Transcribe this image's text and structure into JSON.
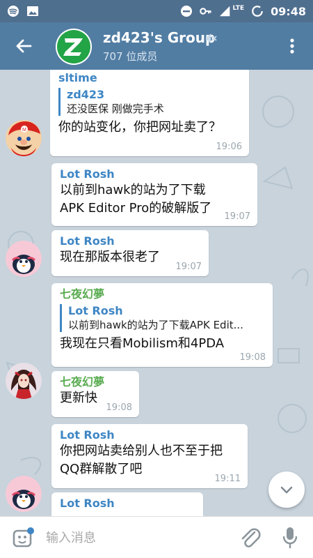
{
  "status_bar": {
    "time": "09:48",
    "network": "LTE",
    "icons": [
      "spotify-icon",
      "image-icon",
      "do-not-disturb-icon",
      "key-icon",
      "signal-icon",
      "battery-icon"
    ]
  },
  "header": {
    "title": "zd423's Group",
    "members": "707 位成员",
    "avatar_letter": "Z",
    "muted": true
  },
  "messages": [
    {
      "sender": "sltime",
      "sender_color": "#3e86c4",
      "reply_name": "zd423",
      "reply_text": "还没医保 刚做完手术",
      "text": "你的站变化，你把网址卖了？",
      "time": "19:06",
      "avatar": "mario-avatar"
    },
    {
      "sender": "Lot Rosh",
      "sender_color": "#3e86c4",
      "text_lines": [
        "以前到hawk的站为了下载",
        "APK Editor Pro的破解版了"
      ],
      "time": "19:07"
    },
    {
      "sender": "Lot Rosh",
      "sender_color": "#3e86c4",
      "text": "现在那版本很老了",
      "time": "19:07",
      "avatar": "penguin-avatar"
    },
    {
      "sender": "七夜幻夢",
      "sender_color": "#5aac52",
      "reply_name": "Lot Rosh",
      "reply_text": "以前到hawk的站为了下载APK Edit...",
      "text": "我现在只看Mobilism和4PDA",
      "time": "19:08"
    },
    {
      "sender": "七夜幻夢",
      "sender_color": "#5aac52",
      "text": "更新快",
      "time": "19:08",
      "avatar": "anime-girl-avatar"
    },
    {
      "sender": "Lot Rosh",
      "sender_color": "#3e86c4",
      "text_lines": [
        "你把网站卖给别人也不至于把",
        "QQ群解散了吧"
      ],
      "time": "19:11",
      "avatar": "penguin-avatar"
    },
    {
      "sender": "Lot Rosh",
      "sender_color": "#3e86c4"
    }
  ],
  "composer": {
    "placeholder": "输入消息"
  },
  "colors": {
    "status_bar": "#4f6f8f",
    "app_bar": "#527da3",
    "chat_bg": "#c8d3dc",
    "link_blue": "#3e86c4",
    "green_name": "#5aac52"
  }
}
